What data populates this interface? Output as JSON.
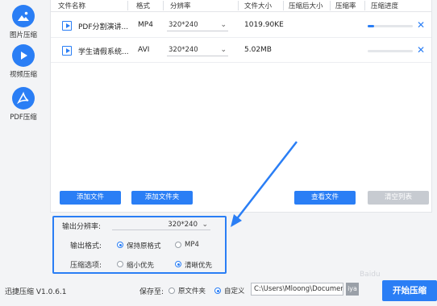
{
  "sidebar": {
    "items": [
      {
        "label": "图片压缩",
        "icon": "image-icon"
      },
      {
        "label": "视频压缩",
        "icon": "play-icon"
      },
      {
        "label": "PDF压缩",
        "icon": "pdf-icon"
      }
    ]
  },
  "table": {
    "columns": [
      "文件名称",
      "格式",
      "分辨率",
      "文件大小",
      "压缩后大小",
      "压缩率",
      "压缩进度"
    ],
    "rows": [
      {
        "name": "PDF分割演讲...",
        "format": "MP4",
        "resolution": "320*240",
        "size": "1019.90KE",
        "compressed": "",
        "rate": "",
        "progress": 0.15
      },
      {
        "name": "学生请假系统...",
        "format": "AVI",
        "resolution": "320*240",
        "size": "5.02MB",
        "compressed": "",
        "rate": "",
        "progress": 0
      }
    ]
  },
  "buttons": {
    "add_file": "添加文件",
    "add_folder": "添加文件夹",
    "view_file": "查看文件",
    "clear_list": "清空列表",
    "start": "开始压缩"
  },
  "settings": {
    "resolution_label": "输出分辨率:",
    "resolution_value": "320*240",
    "format_label": "输出格式:",
    "format_options": [
      {
        "label": "保持原格式",
        "selected": true
      },
      {
        "label": "MP4",
        "selected": false
      }
    ],
    "compress_label": "压缩选项:",
    "compress_options": [
      {
        "label": "缩小优先",
        "selected": false
      },
      {
        "label": "清晰优先",
        "selected": true
      }
    ]
  },
  "bottom": {
    "version": "迅捷压缩 V1.0.6.1",
    "save_label": "保存至:",
    "save_options": [
      {
        "label": "原文件夹",
        "selected": false
      },
      {
        "label": "自定义",
        "selected": true
      }
    ],
    "path": "C:\\Users\\Mloong\\Documents",
    "browse_label": "iya"
  },
  "watermark": "Baidu",
  "colors": {
    "accent": "#2a7ef5",
    "gray_button": "#c7cbd1"
  }
}
